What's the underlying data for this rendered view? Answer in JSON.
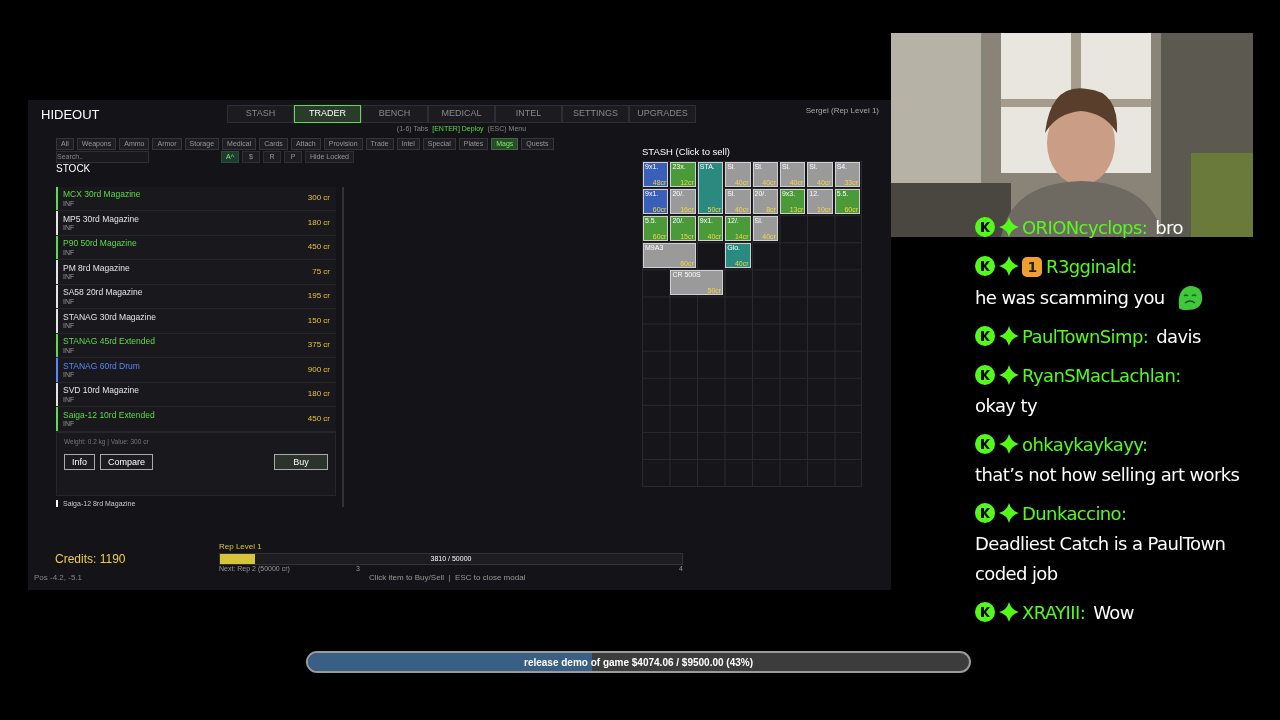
{
  "game": {
    "title": "HIDEOUT",
    "tabs": [
      {
        "label": "STASH",
        "selected": false
      },
      {
        "label": "TRADER",
        "selected": true
      },
      {
        "label": "BENCH",
        "selected": false
      },
      {
        "label": "MEDICAL",
        "selected": false
      },
      {
        "label": "INTEL",
        "selected": false
      },
      {
        "label": "SETTINGS",
        "selected": false
      },
      {
        "label": "UPGRADES",
        "selected": false
      }
    ],
    "player": "Sergei (Rep Level 1)",
    "hints": [
      {
        "text": "(1-6) Tabs",
        "highlight": false
      },
      {
        "text": "[ENTER] Deploy",
        "highlight": true
      },
      {
        "text": "(ESC) Menu",
        "highlight": false
      }
    ],
    "categories": [
      {
        "label": "All",
        "selected": false
      },
      {
        "label": "Weapons",
        "selected": false
      },
      {
        "label": "Ammo",
        "selected": false
      },
      {
        "label": "Armor",
        "selected": false
      },
      {
        "label": "Storage",
        "selected": false
      },
      {
        "label": "Medical",
        "selected": false
      },
      {
        "label": "Cards",
        "selected": false
      },
      {
        "label": "Attach",
        "selected": false
      },
      {
        "label": "Provision",
        "selected": false
      },
      {
        "label": "Trade",
        "selected": false
      },
      {
        "label": "Intel",
        "selected": false
      },
      {
        "label": "Special",
        "selected": false
      },
      {
        "label": "Plates",
        "selected": false
      },
      {
        "label": "Mags",
        "selected": true
      },
      {
        "label": "Quests",
        "selected": false
      }
    ],
    "search": {
      "placeholder": "Search.."
    },
    "sort_buttons": [
      {
        "label": "A^",
        "selected": true
      },
      {
        "label": "$",
        "selected": false
      },
      {
        "label": "R",
        "selected": false
      },
      {
        "label": "P",
        "selected": false
      }
    ],
    "hide_locked": "Hide Locked",
    "stock": {
      "title": "STOCK",
      "items": [
        {
          "name": "MCX 30rd Magazine",
          "stock": "INF",
          "price": "300 cr",
          "color": "#5fdc4a"
        },
        {
          "name": "MP5 30rd Magazine",
          "stock": "INF",
          "price": "180 cr",
          "color": "#e5e5e5"
        },
        {
          "name": "P90 50rd Magazine",
          "stock": "INF",
          "price": "450 cr",
          "color": "#5fdc4a"
        },
        {
          "name": "PM 8rd Magazine",
          "stock": "INF",
          "price": "75 cr",
          "color": "#e5e5e5"
        },
        {
          "name": "SA58 20rd Magazine",
          "stock": "INF",
          "price": "195 cr",
          "color": "#e5e5e5"
        },
        {
          "name": "STANAG 30rd Magazine",
          "stock": "INF",
          "price": "150 cr",
          "color": "#e5e5e5"
        },
        {
          "name": "STANAG 45rd Extended",
          "stock": "INF",
          "price": "375 cr",
          "color": "#5fdc4a"
        },
        {
          "name": "STANAG 60rd Drum",
          "stock": "INF",
          "price": "900 cr",
          "color": "#5a86ff"
        },
        {
          "name": "SVD 10rd Magazine",
          "stock": "INF",
          "price": "180 cr",
          "color": "#e5e5e5"
        },
        {
          "name": "Saiga-12 10rd Extended",
          "stock": "INF",
          "price": "450 cr",
          "color": "#5fdc4a"
        }
      ],
      "details": "Weight: 0.2 kg | Value: 300 cr",
      "buttons": [
        "Info",
        "Compare"
      ],
      "buy": "Buy",
      "next_item": "Saiga-12 8rd Magazine"
    },
    "stash": {
      "title": "STASH (Click to sell)",
      "items": [
        {
          "kind": "cell",
          "name": "9x1.",
          "value": "48cr",
          "color": "#3a5fb8"
        },
        {
          "kind": "cell",
          "name": "23x.",
          "value": "12cr",
          "color": "#4a9a3a"
        },
        {
          "kind": "tall",
          "name": "STA.",
          "value": "50cr",
          "color": "#2a8a80"
        },
        {
          "kind": "cell",
          "name": "Sl.",
          "value": "40cr",
          "color": "#9a9a9a"
        },
        {
          "kind": "cell",
          "name": "Sl.",
          "value": "40cr",
          "color": "#9a9a9a"
        },
        {
          "kind": "cell",
          "name": "Sl.",
          "value": "40cr",
          "color": "#9a9a9a"
        },
        {
          "kind": "cell",
          "name": "Sl.",
          "value": "40cr",
          "color": "#9a9a9a"
        },
        {
          "kind": "cell",
          "name": "S4.",
          "value": "33cr",
          "color": "#9a9a9a"
        },
        {
          "kind": "cell",
          "name": "9x1.",
          "value": "60cr",
          "color": "#3a5fb8"
        },
        {
          "kind": "cell",
          "name": "20/.",
          "value": "16cr",
          "color": "#9a9a9a"
        },
        {
          "kind": "cell",
          "name": "Sl.",
          "value": "40cr",
          "color": "#9a9a9a"
        },
        {
          "kind": "cell",
          "name": "20/.",
          "value": "8cr",
          "color": "#9a9a9a"
        },
        {
          "kind": "cell",
          "name": "9x3.",
          "value": "13cr",
          "color": "#4a9a3a"
        },
        {
          "kind": "cell",
          "name": "12.",
          "value": "10cr",
          "color": "#9a9a9a"
        },
        {
          "kind": "cell",
          "name": "5.5.",
          "value": "60cr",
          "color": "#4a9a3a"
        },
        {
          "kind": "cell",
          "name": "5.5.",
          "value": "60cr",
          "color": "#4a9a3a"
        },
        {
          "kind": "cell",
          "name": "20/.",
          "value": "15cr",
          "color": "#4a9a3a"
        },
        {
          "kind": "cell",
          "name": "9x1.",
          "value": "40cr",
          "color": "#4a9a3a"
        },
        {
          "kind": "cell",
          "name": "12/.",
          "value": "14cr",
          "color": "#4a9a3a"
        },
        {
          "kind": "cell",
          "name": "Sl.",
          "value": "40cr",
          "color": "#9a9a9a"
        },
        {
          "kind": "empty"
        },
        {
          "kind": "empty"
        },
        {
          "kind": "empty"
        },
        {
          "kind": "wide",
          "name": "M9A3",
          "value": "60cr",
          "color": "#9a9a9a"
        },
        {
          "kind": "empty"
        },
        {
          "kind": "cell",
          "name": "Glo.",
          "value": "40cr",
          "color": "#2a8a80"
        },
        {
          "kind": "empty"
        },
        {
          "kind": "empty"
        },
        {
          "kind": "empty"
        },
        {
          "kind": "empty"
        },
        {
          "kind": "empty"
        },
        {
          "kind": "wide",
          "name": "CR 500S",
          "value": "50cr",
          "color": "#9a9a9a"
        }
      ]
    },
    "credits": "Credits: 1190",
    "position": "Pos -4.2, -5.1",
    "rep": {
      "label": "Rep Level 1",
      "level": 0.076,
      "reading": "3810 / 50000",
      "next": "Next: Rep 2 (50000 cr)",
      "ticks": [
        "3",
        "4"
      ]
    },
    "help": "Click item to Buy/Sell  |  ESC to close modal"
  },
  "chat": [
    {
      "user": "ORIONcyclops:",
      "text": "bro",
      "emote": false
    },
    {
      "user": "R3gginald:",
      "badge": "1",
      "text": "he was scamming you",
      "emote": true
    },
    {
      "user": "PaulTownSimp:",
      "text": "davis",
      "emote": false
    },
    {
      "user": "RyanSMacLachlan:",
      "text": "okay ty",
      "emote": false
    },
    {
      "user": "ohkaykaykayy:",
      "text": "that’s not how selling art works",
      "emote": false
    },
    {
      "user": "Dunkaccino:",
      "text": "Deadliest Catch is a PaulTown coded job",
      "emote": false
    },
    {
      "user": "XRAYIII:",
      "text": "Wow",
      "emote": false
    }
  ],
  "goal": {
    "text": "release demo of game $4074.06 / $9500.00 (43%)",
    "level": 0.43
  }
}
